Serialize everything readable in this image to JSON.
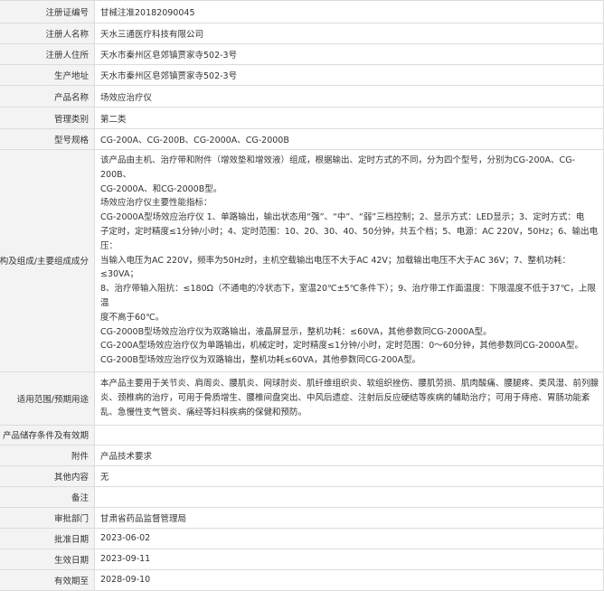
{
  "rows": [
    {
      "label": "注册证编号",
      "lines": [
        "甘械注准20182090045"
      ]
    },
    {
      "label": "注册人名称",
      "lines": [
        "天水三通医疗科技有限公司"
      ]
    },
    {
      "label": "注册人住所",
      "lines": [
        "天水市秦州区皂郊镇贾家寺502-3号"
      ]
    },
    {
      "label": "生产地址",
      "lines": [
        "天水市秦州区皂郊镇贾家寺502-3号"
      ]
    },
    {
      "label": "产品名称",
      "lines": [
        "场效应治疗仪"
      ]
    },
    {
      "label": "管理类别",
      "lines": [
        "第二类"
      ]
    },
    {
      "label": "型号规格",
      "lines": [
        "CG-200A、CG-200B、CG-2000A、CG-2000B"
      ]
    },
    {
      "label": "结构及组成/主要组成成分",
      "lines": [
        "该产品由主机、治疗带和附件（增效垫和增效液）组成，根据输出、定时方式的不同，分为四个型号，分别为CG-200A、CG-200B、",
        "CG-2000A、和CG-2000B型。",
        "场效应治疗仪主要性能指标：",
        "CG-2000A型场效应治疗仪 1、单路输出，输出状态用“强”、“中”、“弱”三档控制；2、显示方式：LED显示；3、定时方式：电",
        "子定时，定时精度≤1分钟/小时；4、定时范围：10、20、30、40、50分钟，共五个档；5、电源：AC 220V，50Hz；6、输出电压：",
        "当输入电压为AC 220V，频率为50Hz时，主机空载输出电压不大于AC 42V；加载输出电压不大于AC 36V；7、整机功耗：≤30VA；",
        "8、治疗带输入阻抗：≤180Ω（不通电的冷状态下，室温20℃±5℃条件下）；9、治疗带工作面温度：下限温度不低于37℃，上限温",
        "度不高于60℃。",
        "CG-2000B型场效应治疗仪为双路输出，液晶屏显示，整机功耗：≤60VA，其他参数同CG-2000A型。",
        "CG-200A型场效应治疗仪为单路输出，机械定时，定时精度≤1分钟/小时，定时范围：0～60分钟，其他参数同CG-2000A型。",
        "CG-200B型场效应治疗仪为双路输出，整机功耗≤60VA，其他参数同CG-200A型。"
      ]
    },
    {
      "label": "适用范围/预期用途",
      "lines": [
        "本产品主要用于关节炎、肩周炎、腰肌炎、网球肘炎、肌纤维组织炎、软组织挫伤、腰肌劳损、肌肉酸痛、腰腿疼、类风湿、前列腺",
        "炎、颈椎病的治疗，可用于骨质增生、腰椎间盘突出、中风后遗症、注射后反应硬结等疾病的辅助治疗；可用于痔疮、胃肠功能紊",
        "乱、急慢性支气管炎、痛经等妇科疾病的保健和预防。"
      ]
    },
    {
      "label": "产品储存条件及有效期",
      "lines": [
        ""
      ]
    },
    {
      "label": "附件",
      "lines": [
        "产品技术要求"
      ]
    },
    {
      "label": "其他内容",
      "lines": [
        "无"
      ]
    },
    {
      "label": "备注",
      "lines": [
        ""
      ]
    },
    {
      "label": "审批部门",
      "lines": [
        "甘肃省药品监督管理局"
      ]
    },
    {
      "label": "批准日期",
      "lines": [
        "2023-06-02"
      ]
    },
    {
      "label": "生效日期",
      "lines": [
        "2023-09-11"
      ]
    },
    {
      "label": "有效期至",
      "lines": [
        "2028-09-10"
      ]
    }
  ]
}
